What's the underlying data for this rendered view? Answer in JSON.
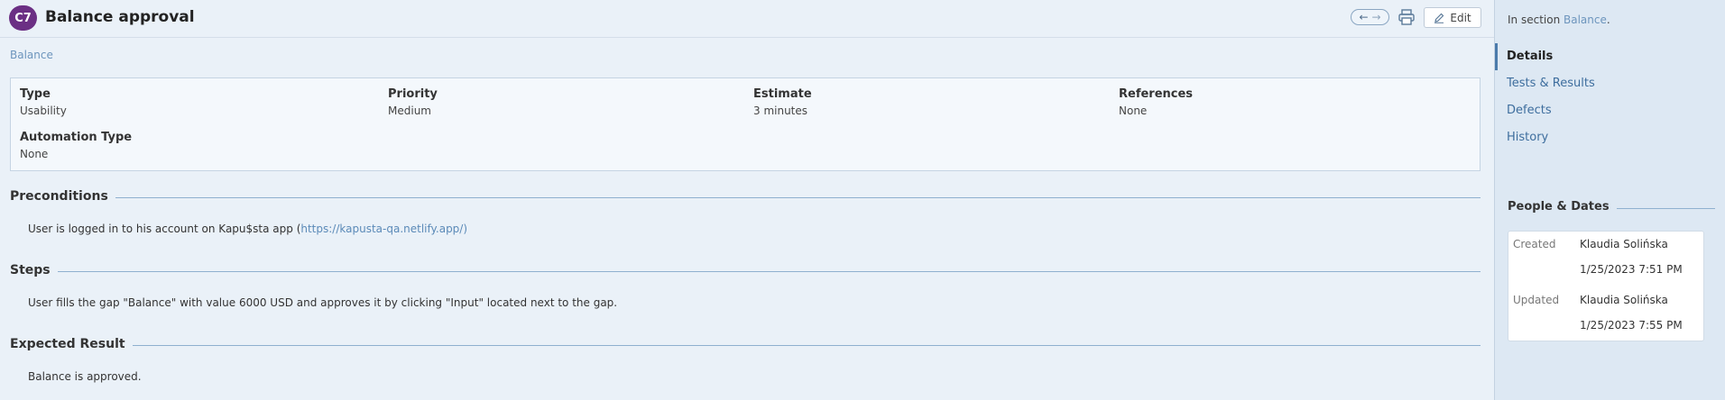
{
  "header": {
    "badge": "C7",
    "title": "Balance approval",
    "edit_label": "Edit",
    "nav_prev_icon": "←",
    "nav_next_icon": "→"
  },
  "breadcrumb": "Balance",
  "fields": [
    {
      "label": "Type",
      "value": "Usability"
    },
    {
      "label": "Priority",
      "value": "Medium"
    },
    {
      "label": "Estimate",
      "value": "3 minutes"
    },
    {
      "label": "References",
      "value": "None"
    },
    {
      "label": "Automation Type",
      "value": "None"
    }
  ],
  "sections": {
    "preconditions": {
      "title": "Preconditions",
      "text": "User is logged in to his account on Kapu$sta app (",
      "link": "https://kapusta-qa.netlify.app/",
      "text_after": ")"
    },
    "steps": {
      "title": "Steps",
      "text": "User fills the gap \"Balance\" with value 6000 USD and approves it by clicking \"Input\" located next to the gap."
    },
    "expected": {
      "title": "Expected Result",
      "text": "Balance is approved."
    }
  },
  "sidebar": {
    "in_section_prefix": "In section ",
    "in_section_link": "Balance",
    "in_section_suffix": ".",
    "nav": [
      "Details",
      "Tests & Results",
      "Defects",
      "History"
    ],
    "people_dates_title": "People & Dates",
    "created_label": "Created",
    "created_by": "Klaudia Solińska",
    "created_at": "1/25/2023 7:51 PM",
    "updated_label": "Updated",
    "updated_by": "Klaudia Solińska",
    "updated_at": "1/25/2023 7:55 PM"
  },
  "colors": {
    "badge": "#6b2f84",
    "link": "#6d95bd",
    "background": "#eaf1f8",
    "sidebar": "#dde8f3"
  },
  "icons": {
    "print": "printer-icon",
    "edit": "pencil-icon"
  }
}
